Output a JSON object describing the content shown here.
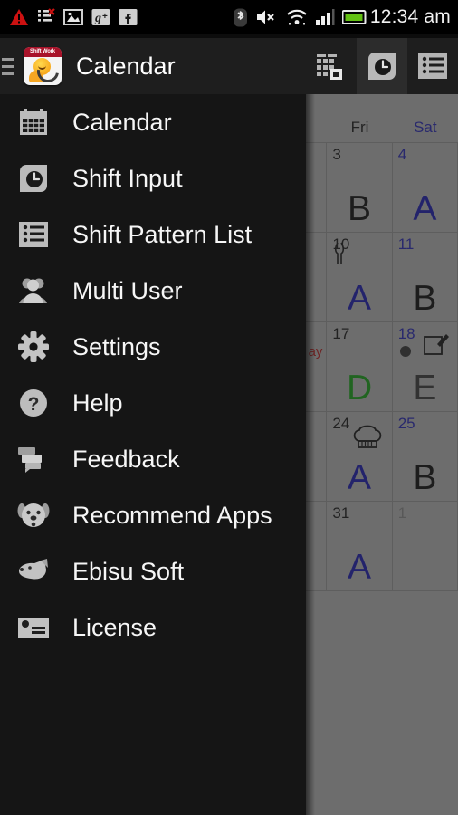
{
  "status_bar": {
    "time": "12:34 am",
    "left_icons": [
      {
        "name": "warning-triangle-icon"
      },
      {
        "name": "sync-error-icon"
      },
      {
        "name": "image-icon"
      },
      {
        "name": "google-plus-icon"
      },
      {
        "name": "facebook-icon"
      }
    ],
    "right_icons": [
      {
        "name": "bluetooth-icon"
      },
      {
        "name": "volume-mute-icon"
      },
      {
        "name": "wifi-icon"
      },
      {
        "name": "cellular-signal-icon"
      },
      {
        "name": "battery-icon"
      }
    ],
    "battery_color": "#63c113"
  },
  "app_bar": {
    "title": "Calendar",
    "logo_banner": "Shift Work",
    "menu_icon": "hamburger-menu-icon",
    "actions": [
      {
        "name": "month-view-icon",
        "label": "Month View"
      },
      {
        "name": "shift-input-clock-icon",
        "label": "Shift Input"
      },
      {
        "name": "shift-pattern-list-icon",
        "label": "Shift Pattern List"
      }
    ]
  },
  "drawer": {
    "items": [
      {
        "label": "Calendar",
        "icon": "calendar-icon"
      },
      {
        "label": "Shift Input",
        "icon": "clock-icon"
      },
      {
        "label": "Shift Pattern List",
        "icon": "list-icon"
      },
      {
        "label": "Multi User",
        "icon": "people-icon"
      },
      {
        "label": "Settings",
        "icon": "gear-icon"
      },
      {
        "label": "Help",
        "icon": "question-mark-icon"
      },
      {
        "label": "Feedback",
        "icon": "chat-bubbles-icon"
      },
      {
        "label": "Recommend Apps",
        "icon": "dog-face-icon"
      },
      {
        "label": "Ebisu Soft",
        "icon": "dog-head-icon"
      },
      {
        "label": "License",
        "icon": "license-card-icon"
      }
    ]
  },
  "calendar": {
    "weekdays": [
      {
        "label": "Fri",
        "kind": "weekday"
      },
      {
        "label": "Sat",
        "kind": "sat"
      }
    ],
    "weeks": [
      [
        {
          "day": "3",
          "shift": "B",
          "shift_color": "dark",
          "kind": "weekday"
        },
        {
          "day": "4",
          "shift": "A",
          "shift_color": "blue",
          "kind": "sat"
        }
      ],
      [
        {
          "day": "10",
          "shift": "A",
          "shift_color": "blue",
          "kind": "weekday",
          "mark": "knife-icon"
        },
        {
          "day": "11",
          "shift": "B",
          "shift_color": "dark",
          "kind": "sat"
        }
      ],
      [
        {
          "day": "17",
          "shift": "D",
          "shift_color": "green",
          "kind": "weekday",
          "holiday": "ay"
        },
        {
          "day": "18",
          "shift": "E",
          "shift_color": "grey",
          "kind": "sat",
          "memo_dot": true,
          "mark": "edit-icon"
        }
      ],
      [
        {
          "day": "24",
          "shift": "A",
          "shift_color": "blue",
          "kind": "weekday",
          "mark": "chef-hat-icon"
        },
        {
          "day": "25",
          "shift": "B",
          "shift_color": "dark",
          "kind": "sat"
        }
      ],
      [
        {
          "day": "31",
          "shift": "A",
          "shift_color": "blue",
          "kind": "weekday"
        },
        {
          "day": "1",
          "shift": "",
          "shift_color": "dark",
          "kind": "other"
        }
      ]
    ]
  },
  "colors": {
    "drawer_bg": "#151515",
    "appbar_bg": "#1e1e1e",
    "statusbar_bg": "#000000",
    "calendar_bg": "#b8b8b8",
    "scrim": "rgba(40,40,40,0.52)",
    "accent_blue": "#1f1fb4",
    "accent_green": "#1aa61a",
    "accent_red": "#bb2222"
  }
}
